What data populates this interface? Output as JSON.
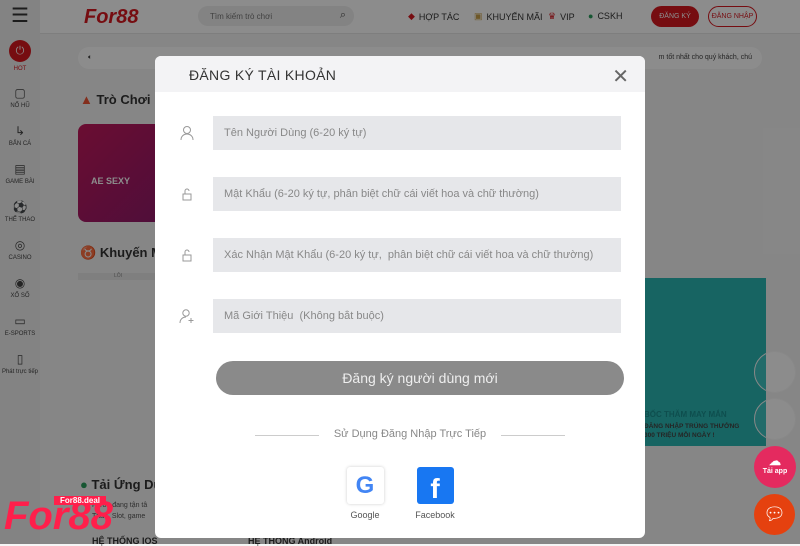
{
  "header": {
    "menu_icon": "hamburger-icon",
    "logo": "For88",
    "search_placeholder": "Tìm kiếm trò chơi",
    "nav": [
      "HỢP TÁC",
      "KHUYẾN MÃI",
      "VIP",
      "CSKH"
    ],
    "register": "ĐĂNG KÝ",
    "login": "ĐĂNG NHẬP"
  },
  "sidebar": {
    "items": [
      "HOT",
      "NỔ HŨ",
      "BẮN CÁ",
      "GAME BÀI",
      "THỂ THAO",
      "CASINO",
      "XỔ SỐ",
      "E-SPORTS",
      "Phát trực tiếp"
    ]
  },
  "main": {
    "notice": "m tốt nhất cho quý khách, chú",
    "hot_title": "Trò Chơi N",
    "card_label": "AE SEXY",
    "promo_title": "Khuyến Mã",
    "promo_tab": "LỖI",
    "app_title": "Tải Ứng Dụ",
    "app_desc1": "For88 đang tận tâ",
    "app_desc2": "Thao, Slot, game",
    "ios": "HỆ THỐNG IOS",
    "android": "HỆ THỐNG Android",
    "banner_title": "BỐC THĂM MAY MẮN",
    "banner_sub1": "ĐĂNG NHẬP TRÚNG THƯỞNG",
    "banner_sub2": "300 TRIỆU MỖI NGÀY !"
  },
  "floating": {
    "download": "Tải app",
    "watermark": "For88",
    "watermark_tag": "For88.deal"
  },
  "modal": {
    "title": "ĐĂNG KÝ TÀI KHOẢN",
    "fields": [
      {
        "placeholder": "Tên Người Dùng (6-20 ký tự)",
        "icon": "user-icon"
      },
      {
        "placeholder": "Mật Khẩu (6-20 ký tự, phân biệt chữ cái viết hoa và chữ thường)",
        "icon": "lock-icon"
      },
      {
        "placeholder": "Xác Nhận Mật Khẩu (6-20 ký tự,  phân biệt chữ cái viết hoa và chữ thường)",
        "icon": "lock-icon"
      },
      {
        "placeholder": "Mã Giới Thiệu  (Không bắt buộc)",
        "icon": "user-plus-icon"
      }
    ],
    "submit": "Đăng ký người dùng mới",
    "divider": "Sử Dụng Đăng Nhập Trực Tiếp",
    "google": "Google",
    "facebook": "Facebook"
  },
  "colors": {
    "brand": "#d71920",
    "button": "#8a8a8a",
    "input_bg": "#e6e7ea"
  }
}
